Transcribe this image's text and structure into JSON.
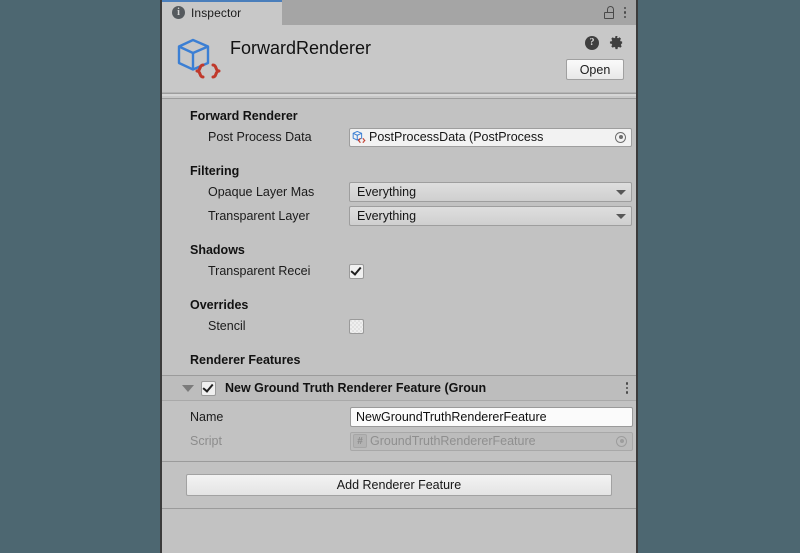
{
  "window": {
    "tab_label": "Inspector",
    "tab_icon": "info-icon",
    "lock_icon": "lock-open-icon",
    "menu_icon": "kebab-menu-icon"
  },
  "asset_header": {
    "title": "ForwardRenderer",
    "icon": "scriptable-object-icon",
    "help_icon": "help-icon",
    "gear_icon": "gear-icon",
    "open_label": "Open"
  },
  "sections": {
    "forward_renderer": {
      "header": "Forward Renderer",
      "post_process_data": {
        "label": "Post Process Data",
        "value": "PostProcessData (PostProcess",
        "icon": "scriptable-object-icon",
        "picker_icon": "object-picker-icon"
      }
    },
    "filtering": {
      "header": "Filtering",
      "opaque_layer_mask": {
        "label": "Opaque Layer Mas",
        "value": "Everything",
        "chevron_icon": "chevron-down-icon"
      },
      "transparent_layer_mask": {
        "label": "Transparent Layer",
        "value": "Everything",
        "chevron_icon": "chevron-down-icon"
      }
    },
    "shadows": {
      "header": "Shadows",
      "transparent_receive": {
        "label": "Transparent Recei",
        "checked": true
      }
    },
    "overrides": {
      "header": "Overrides",
      "stencil": {
        "label": "Stencil",
        "checked": false
      }
    },
    "renderer_features": {
      "header": "Renderer Features",
      "feature": {
        "title": "New Ground Truth Renderer Feature (Groun",
        "enabled": true,
        "foldout_icon": "foldout-expanded-icon",
        "menu_icon": "kebab-menu-icon",
        "name_label": "Name",
        "name_value": "NewGroundTruthRendererFeature",
        "script_label": "Script",
        "script_value": "GroundTruthRendererFeature",
        "script_badge": "csharp-script-icon",
        "script_picker_icon": "object-picker-icon"
      },
      "add_button_label": "Add Renderer Feature"
    }
  },
  "colors": {
    "desktop_background": "#4d6771",
    "panel_background": "#c2c2c2",
    "tab_accent": "#4a7ebb",
    "icon_blue": "#3b7fd4",
    "icon_red": "#c0392b"
  }
}
